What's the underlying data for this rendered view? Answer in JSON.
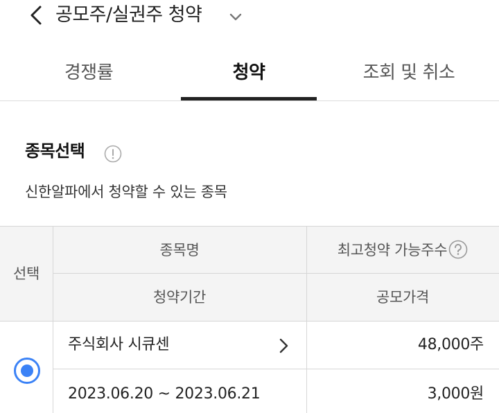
{
  "header": {
    "title": "공모주/실권주 청약"
  },
  "tabs": [
    {
      "label": "경쟁률"
    },
    {
      "label": "청약"
    },
    {
      "label": "조회 및 취소"
    }
  ],
  "section": {
    "title": "종목선택",
    "description": "신한알파에서 청약할 수 있는 종목"
  },
  "table": {
    "headers": {
      "select": "선택",
      "name": "종목명",
      "max_shares": "최고청약 가능주수",
      "period": "청약기간",
      "price": "공모가격"
    },
    "rows": [
      {
        "name": "주식회사 시큐센",
        "max_shares": "48,000주",
        "period": "2023.06.20 ~ 2023.06.21",
        "price": "3,000원",
        "selected": true
      }
    ]
  },
  "colors": {
    "accent": "#3b82f6",
    "header_bg": "#f4f4f4",
    "border": "#d6d6d6"
  },
  "icons": [
    "back-arrow-icon",
    "chevron-down-icon",
    "info-icon",
    "question-icon",
    "chevron-right-icon"
  ]
}
